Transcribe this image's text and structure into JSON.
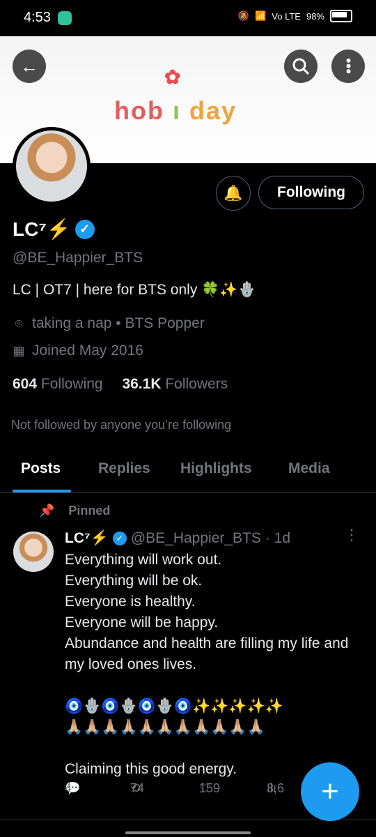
{
  "status": {
    "time": "4:53",
    "battery": "98%",
    "network": "Vo LTE"
  },
  "banner": {
    "text_part1": "hob",
    "text_part2": "day"
  },
  "profile": {
    "name": "LC⁷⚡",
    "handle": "@BE_Happier_BTS",
    "bio": "LC | OT7 | here for BTS only 🍀✨🪬",
    "location": "taking a nap • BTS Popper",
    "joined": "Joined May 2016",
    "following_count": "604",
    "following_label": "Following",
    "followers_count": "36.1K",
    "followers_label": "Followers",
    "not_followed": "Not followed by anyone you’re following",
    "follow_button": "Following"
  },
  "tabs": [
    {
      "label": "Posts"
    },
    {
      "label": "Replies"
    },
    {
      "label": "Highlights"
    },
    {
      "label": "Media"
    }
  ],
  "post": {
    "pinned_label": "Pinned",
    "author": "LC⁷⚡",
    "handle": "@BE_Happier_BTS",
    "time": "· 1d",
    "text": "Everything will work out.\nEverything will be ok.\nEveryone is healthy.\nEveryone will be happy.\nAbundance and health are filling my life and my loved ones lives.\n\n🧿🪬🧿🪬🧿🪬🧿✨✨✨✨✨\n🙏🏼🙏🏼🙏🏼🙏🏼🙏🏼🙏🏼🙏🏼🙏🏼🙏🏼🙏🏼🙏🏼\n\nClaiming this good energy.",
    "replies": "4",
    "reposts": "74",
    "likes": "159",
    "views": "3,6"
  }
}
